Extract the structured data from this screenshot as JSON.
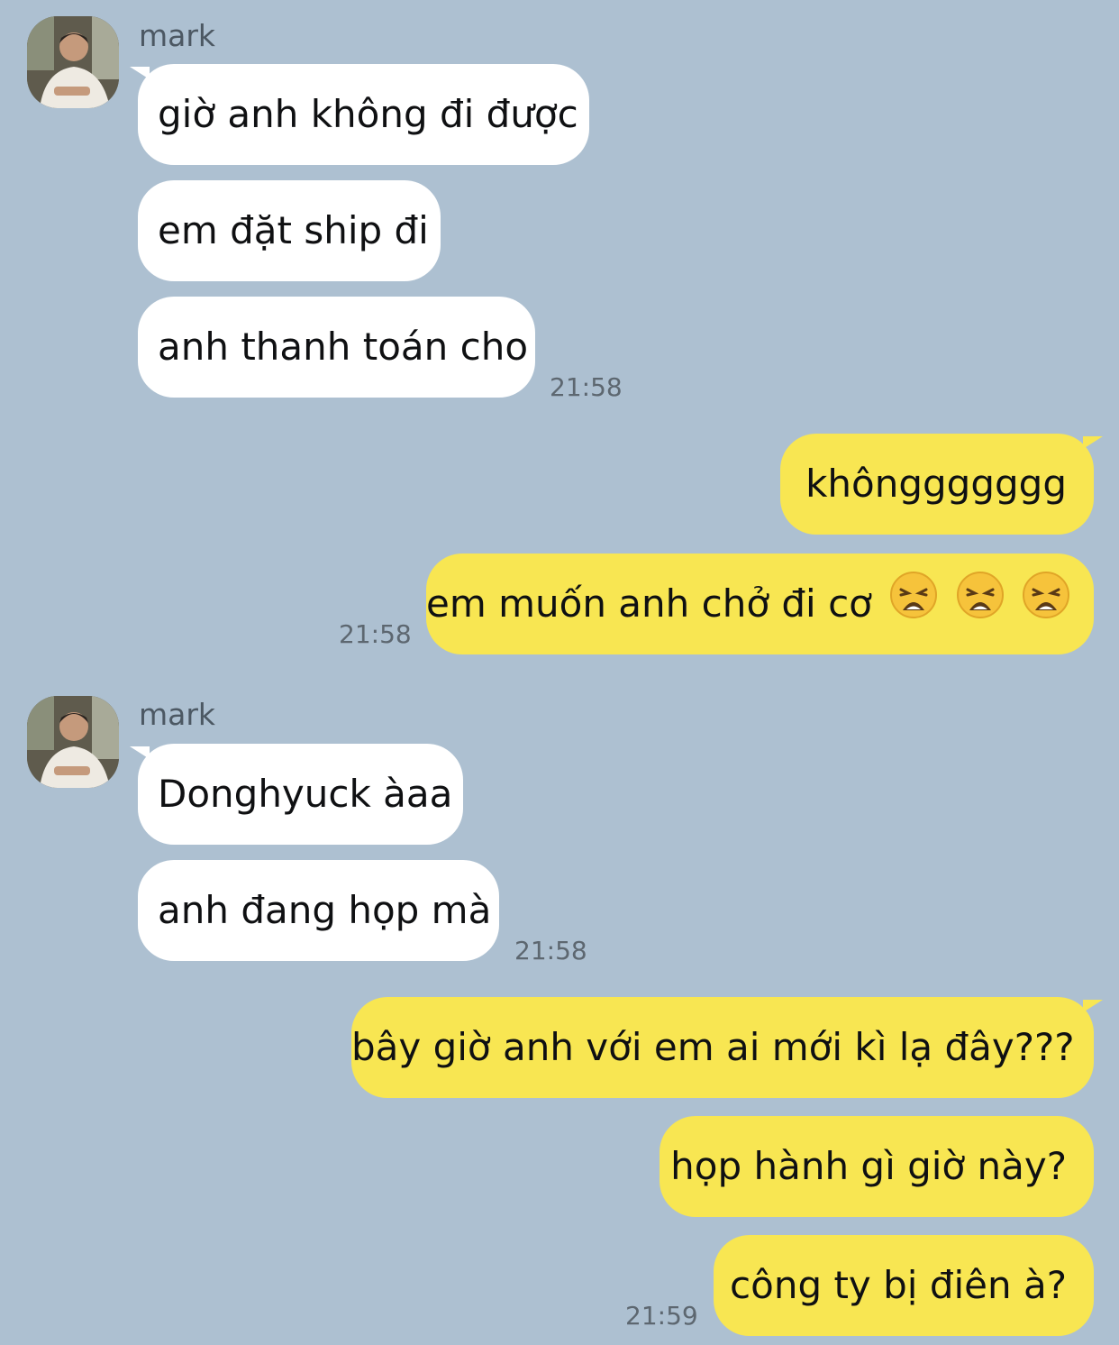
{
  "groups": [
    {
      "sender": "mark",
      "messages": [
        "giờ anh không đi được",
        "em đặt ship đi",
        "anh thanh toán cho"
      ],
      "time": "21:58"
    },
    {
      "sender": "me",
      "messages": [
        "khônggggggg",
        "em muốn anh chở đi cơ"
      ],
      "emoji_count": 3,
      "emoji_name": "weary-face-icon",
      "time": "21:58"
    },
    {
      "sender": "mark",
      "messages": [
        "Donghyuck àaa",
        "anh đang họp mà"
      ],
      "time": "21:58"
    },
    {
      "sender": "me",
      "messages": [
        "bây giờ anh với em ai mới kì lạ đây???",
        "họp hành gì giờ này?",
        "công ty bị điên à?"
      ],
      "time": "21:59"
    }
  ],
  "colors": {
    "background": "#adc0d1",
    "incoming_bubble": "#ffffff",
    "outgoing_bubble": "#f8e652",
    "timestamp": "#5d6770"
  }
}
